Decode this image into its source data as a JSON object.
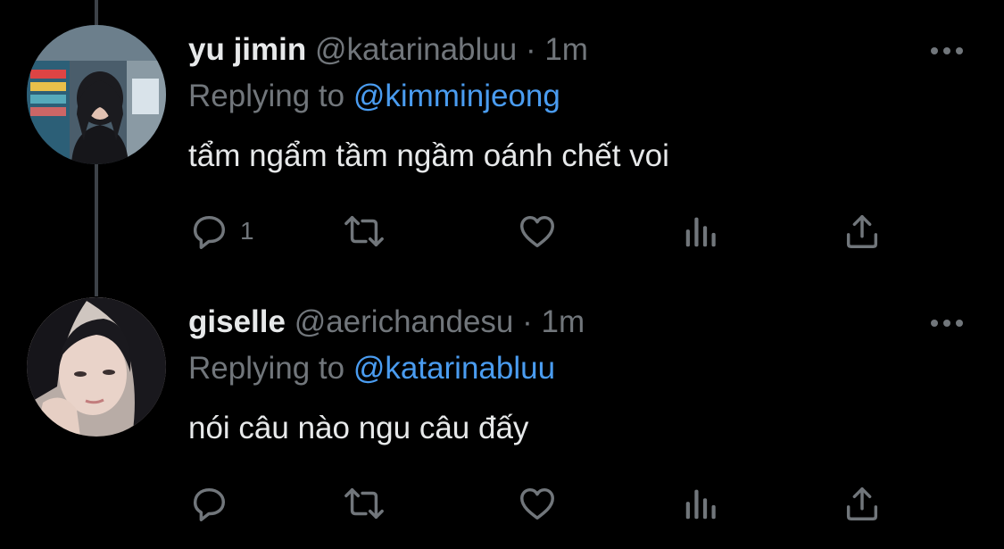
{
  "tweets": [
    {
      "display_name": "yu jimin",
      "handle": "@katarinabluu",
      "separator": "·",
      "time": "1m",
      "replying_prefix": "Replying to",
      "replying_to": "@kimminjeong",
      "text": "tẩm ngẩm tầm ngầm oánh chết voi",
      "reply_count": "1",
      "icons": [
        "reply-icon",
        "retweet-icon",
        "like-icon",
        "views-icon",
        "share-icon",
        "more-icon"
      ]
    },
    {
      "display_name": "giselle",
      "handle": "@aerichandesu",
      "separator": "·",
      "time": "1m",
      "replying_prefix": "Replying to",
      "replying_to": "@katarinabluu",
      "text": "nói câu nào ngu câu đấy",
      "reply_count": "",
      "icons": [
        "reply-icon",
        "retweet-icon",
        "like-icon",
        "views-icon",
        "share-icon",
        "more-icon"
      ]
    }
  ],
  "colors": {
    "background": "#000000",
    "primary_text": "#e7e9ea",
    "secondary_text": "#71767b",
    "mention": "#4a9cf0",
    "thread_line": "#3d4248"
  }
}
